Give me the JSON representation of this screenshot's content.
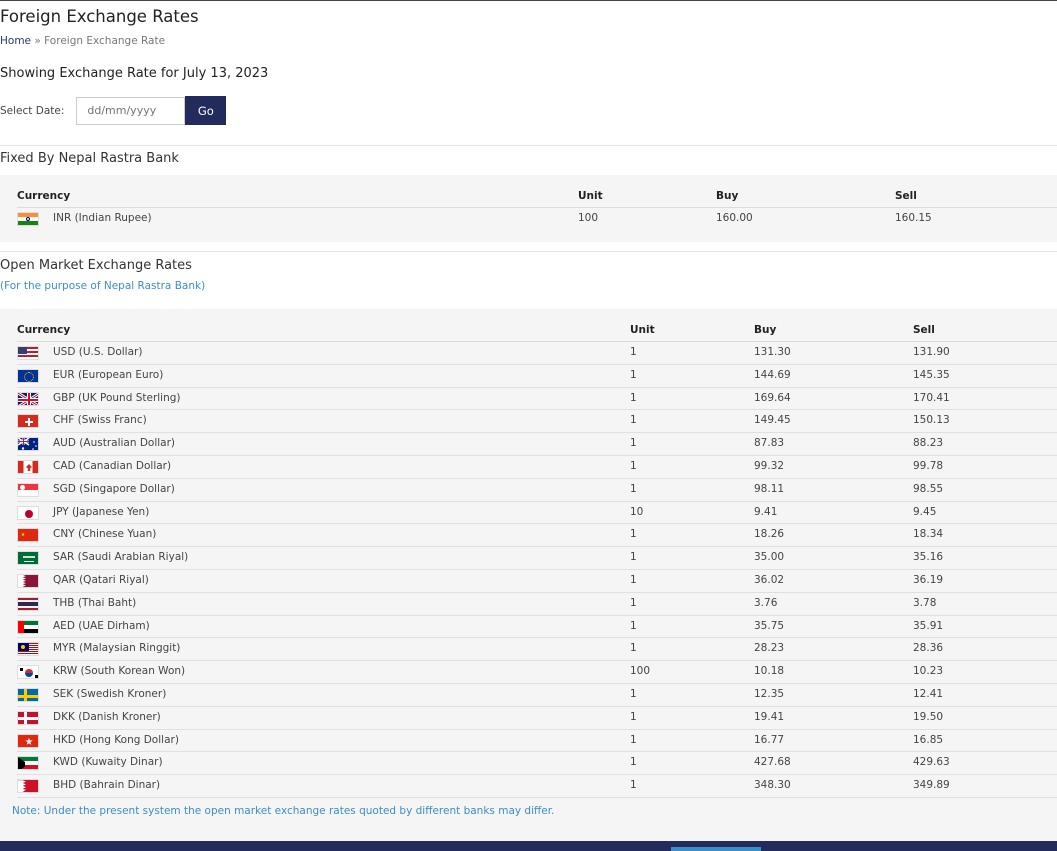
{
  "page": {
    "title": "Foreign Exchange Rates",
    "breadcrumb": {
      "home": "Home",
      "sep": "»",
      "current": "Foreign Exchange Rate"
    },
    "showing": "Showing Exchange Rate for July 13, 2023",
    "date_label": "Select Date:",
    "date_placeholder": "dd/mm/yyyy",
    "go_label": "Go"
  },
  "fixed": {
    "title": "Fixed By Nepal Rastra Bank",
    "headers": [
      "Currency",
      "Unit",
      "Buy",
      "Sell"
    ],
    "rows": [
      {
        "currency": "INR (Indian Rupee)",
        "unit": "100",
        "buy": "160.00",
        "sell": "160.15",
        "flag": "in"
      }
    ]
  },
  "open": {
    "title": "Open Market Exchange Rates",
    "subtitle": "(For the purpose of Nepal Rastra Bank)",
    "headers": [
      "Currency",
      "Unit",
      "Buy",
      "Sell"
    ],
    "rows": [
      {
        "currency": "USD (U.S. Dollar)",
        "unit": "1",
        "buy": "131.30",
        "sell": "131.90",
        "flag": "us"
      },
      {
        "currency": "EUR (European Euro)",
        "unit": "1",
        "buy": "144.69",
        "sell": "145.35",
        "flag": "eu"
      },
      {
        "currency": "GBP (UK Pound Sterling)",
        "unit": "1",
        "buy": "169.64",
        "sell": "170.41",
        "flag": "gb"
      },
      {
        "currency": "CHF (Swiss Franc)",
        "unit": "1",
        "buy": "149.45",
        "sell": "150.13",
        "flag": "ch"
      },
      {
        "currency": "AUD (Australian Dollar)",
        "unit": "1",
        "buy": "87.83",
        "sell": "88.23",
        "flag": "au"
      },
      {
        "currency": "CAD (Canadian Dollar)",
        "unit": "1",
        "buy": "99.32",
        "sell": "99.78",
        "flag": "ca"
      },
      {
        "currency": "SGD (Singapore Dollar)",
        "unit": "1",
        "buy": "98.11",
        "sell": "98.55",
        "flag": "sg"
      },
      {
        "currency": "JPY (Japanese Yen)",
        "unit": "10",
        "buy": "9.41",
        "sell": "9.45",
        "flag": "jp"
      },
      {
        "currency": "CNY (Chinese Yuan)",
        "unit": "1",
        "buy": "18.26",
        "sell": "18.34",
        "flag": "cn"
      },
      {
        "currency": "SAR (Saudi Arabian Riyal)",
        "unit": "1",
        "buy": "35.00",
        "sell": "35.16",
        "flag": "sa"
      },
      {
        "currency": "QAR (Qatari Riyal)",
        "unit": "1",
        "buy": "36.02",
        "sell": "36.19",
        "flag": "qa"
      },
      {
        "currency": "THB (Thai Baht)",
        "unit": "1",
        "buy": "3.76",
        "sell": "3.78",
        "flag": "th"
      },
      {
        "currency": "AED (UAE Dirham)",
        "unit": "1",
        "buy": "35.75",
        "sell": "35.91",
        "flag": "ae"
      },
      {
        "currency": "MYR (Malaysian Ringgit)",
        "unit": "1",
        "buy": "28.23",
        "sell": "28.36",
        "flag": "my"
      },
      {
        "currency": "KRW (South Korean Won)",
        "unit": "100",
        "buy": "10.18",
        "sell": "10.23",
        "flag": "kr"
      },
      {
        "currency": "SEK (Swedish Kroner)",
        "unit": "1",
        "buy": "12.35",
        "sell": "12.41",
        "flag": "se"
      },
      {
        "currency": "DKK (Danish Kroner)",
        "unit": "1",
        "buy": "19.41",
        "sell": "19.50",
        "flag": "dk"
      },
      {
        "currency": "HKD (Hong Kong Dollar)",
        "unit": "1",
        "buy": "16.77",
        "sell": "16.85",
        "flag": "hk"
      },
      {
        "currency": "KWD (Kuwaity Dinar)",
        "unit": "1",
        "buy": "427.68",
        "sell": "429.63",
        "flag": "kw"
      },
      {
        "currency": "BHD (Bahrain Dinar)",
        "unit": "1",
        "buy": "348.30",
        "sell": "349.89",
        "flag": "bh"
      }
    ],
    "note": "Note: Under the present system the open market exchange rates quoted by different banks may differ."
  }
}
